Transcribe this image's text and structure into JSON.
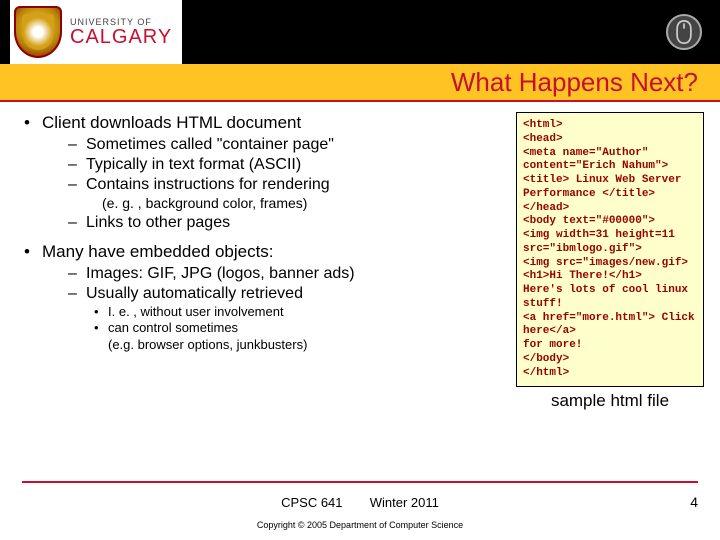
{
  "header": {
    "uni_of": "UNIVERSITY OF",
    "uni_name": "CALGARY"
  },
  "title": "What Happens Next?",
  "bullets": {
    "b1": "Client downloads HTML document",
    "b1s1": "Sometimes called \"container page\"",
    "b1s2": "Typically in text format (ASCII)",
    "b1s3": "Contains instructions for rendering",
    "b1s3n": "(e. g. , background color, frames)",
    "b1s4": "Links to other pages",
    "b2": "Many have embedded objects:",
    "b2s1": "Images: GIF, JPG (logos, banner ads)",
    "b2s2": "Usually automatically retrieved",
    "b2s2a": "I. e. , without user involvement",
    "b2s2b": "can control sometimes",
    "b2s2bn": "(e.g. browser options, junkbusters)"
  },
  "code": "<html>\n<head>\n<meta name=\"Author\" content=\"Erich Nahum\">\n<title> Linux Web Server Performance </title>\n</head>\n<body text=\"#00000\">\n<img width=31 height=11 src=\"ibmlogo.gif\">\n<img src=\"images/new.gif>\n<h1>Hi There!</h1>\nHere's lots of cool linux stuff!\n<a href=\"more.html\"> Click here</a>\nfor more!\n</body>\n</html>",
  "sample_label": "sample html file",
  "footer": {
    "course": "CPSC 641",
    "term": "Winter 2011",
    "page": "4",
    "copyright": "Copyright © 2005 Department of Computer Science"
  }
}
